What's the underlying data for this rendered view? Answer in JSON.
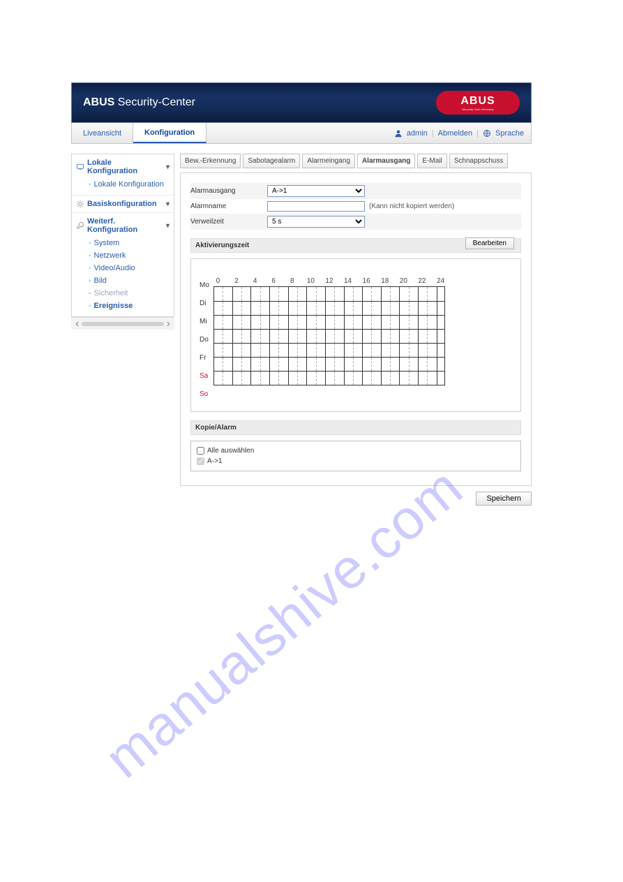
{
  "watermark": "manualshive.com",
  "banner": {
    "brand_bold": "ABUS",
    "brand_rest": " Security-Center",
    "logo_big": "ABUS",
    "logo_small": "Security Tech Germany"
  },
  "topnav": {
    "tabs": [
      {
        "label": "Liveansicht",
        "active": false
      },
      {
        "label": "Konfiguration",
        "active": true
      }
    ],
    "user": "admin",
    "logout": "Abmelden",
    "language": "Sprache"
  },
  "sidebar": {
    "groups": [
      {
        "title": "Lokale Konfiguration",
        "items": [
          {
            "label": "Lokale Konfiguration"
          }
        ]
      },
      {
        "title": "Basiskonfiguration",
        "items": []
      },
      {
        "title": "Weiterf. Konfiguration",
        "items": [
          {
            "label": "System"
          },
          {
            "label": "Netzwerk"
          },
          {
            "label": "Video/Audio"
          },
          {
            "label": "Bild"
          },
          {
            "label": "Sicherheit",
            "muted": true
          },
          {
            "label": "Ereignisse",
            "active": true
          }
        ]
      }
    ]
  },
  "subtabs": [
    {
      "label": "Bew.-Erkennung"
    },
    {
      "label": "Sabotagealarm"
    },
    {
      "label": "Alarmeingang"
    },
    {
      "label": "Alarmausgang",
      "active": true
    },
    {
      "label": "E-Mail"
    },
    {
      "label": "Schnappschuss"
    }
  ],
  "form": {
    "alarm_out_label": "Alarmausgang",
    "alarm_out_value": "A->1",
    "alarmname_label": "Alarmname",
    "alarmname_value": "",
    "alarmname_note": "(Kann nicht kopiert werden)",
    "dwell_label": "Verweilzeit",
    "dwell_value": "5 s"
  },
  "schedule": {
    "title": "Aktivierungszeit",
    "edit_btn": "Bearbeiten",
    "hours": [
      "0",
      "2",
      "4",
      "6",
      "8",
      "10",
      "12",
      "14",
      "16",
      "18",
      "20",
      "22",
      "24"
    ],
    "days": [
      "Mo",
      "Di",
      "Mi",
      "Do",
      "Fr",
      "Sa",
      "So"
    ]
  },
  "copy": {
    "title": "Kopie/Alarm",
    "select_all": "Alle auswählen",
    "item1": "A->1"
  },
  "buttons": {
    "save": "Speichern"
  }
}
